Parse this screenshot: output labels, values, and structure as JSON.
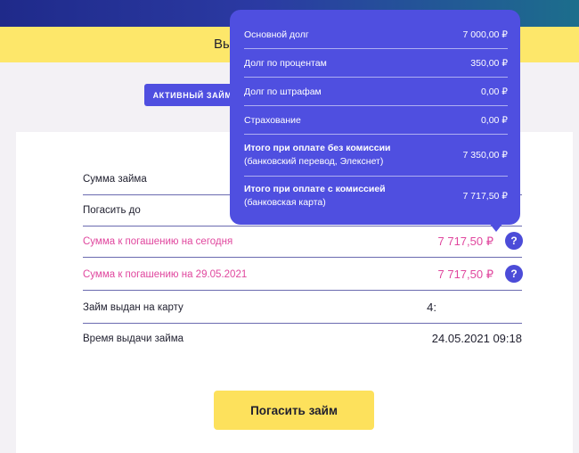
{
  "header": {
    "yellow_text": "Вы"
  },
  "tabs": {
    "active_label": "АКТИВНЫЙ ЗАЙМ"
  },
  "loan_rows": [
    {
      "label": "Сумма займа",
      "value": ""
    },
    {
      "label": "Погасить до",
      "value": ""
    },
    {
      "label": "Сумма к погашению на сегодня",
      "value": "7 717,50 ₽"
    },
    {
      "label": "Сумма к погашению на 29.05.2021",
      "value": "7 717,50 ₽"
    },
    {
      "label": "Займ выдан на карту",
      "value": "4:"
    },
    {
      "label": "Время выдачи займа",
      "value": "24.05.2021 09:18"
    }
  ],
  "help_icon": "?",
  "pay_button": "Погасить займ",
  "popup": {
    "rows": [
      {
        "label": "Основной долг",
        "value": "7 000,00 ₽"
      },
      {
        "label": "Долг по процентам",
        "value": "350,00 ₽"
      },
      {
        "label": "Долг по штрафам",
        "value": "0,00 ₽"
      },
      {
        "label": "Страхование",
        "value": "0,00 ₽"
      },
      {
        "label": "Итого при оплате без комиссии",
        "sublabel": "(банковский перевод, Элекснет)",
        "value": "7 350,00 ₽"
      },
      {
        "label": "Итого при оплате с комиссией",
        "sublabel": "(банковская карта)",
        "value": "7 717,50 ₽"
      }
    ]
  },
  "colors": {
    "accent": "#4f4fe0",
    "pink": "#e0479e",
    "yellow": "#fde76a"
  }
}
